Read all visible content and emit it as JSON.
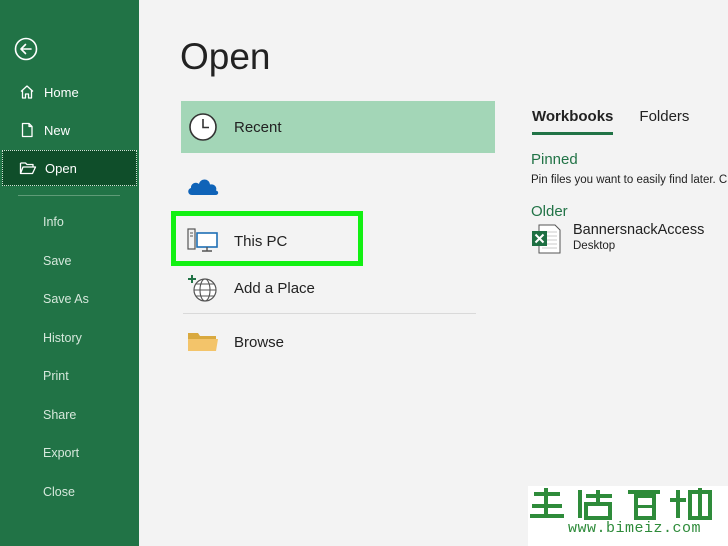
{
  "sidebar": {
    "primary": [
      {
        "label": "Home",
        "icon": "home-icon"
      },
      {
        "label": "New",
        "icon": "new-document-icon"
      },
      {
        "label": "Open",
        "icon": "open-folder-icon",
        "active": true
      }
    ],
    "secondary": [
      "Info",
      "Save",
      "Save As",
      "History",
      "Print",
      "Share",
      "Export",
      "Close"
    ],
    "bg_color": "#217346"
  },
  "main": {
    "title": "Open",
    "locations": [
      {
        "label": "Recent",
        "icon": "clock-icon",
        "selected": true
      },
      {
        "label": "",
        "icon": "onedrive-cloud-icon"
      },
      {
        "label": "This PC",
        "icon": "computer-icon"
      },
      {
        "label": "Add a Place",
        "icon": "add-place-globe-icon"
      },
      {
        "label": "Browse",
        "icon": "folder-icon"
      }
    ]
  },
  "right": {
    "tabs": [
      {
        "label": "Workbooks",
        "active": true
      },
      {
        "label": "Folders"
      }
    ],
    "pinned_heading": "Pinned",
    "pinned_hint": "Pin files you want to easily find later. C",
    "older_heading": "Older",
    "files": [
      {
        "name": "BannersnackAccess",
        "location": "Desktop",
        "icon": "excel-file-icon"
      }
    ]
  },
  "watermark": {
    "url": "www.bimeiz.com"
  },
  "colors": {
    "accent": "#217346",
    "highlight": "#12f012",
    "selected": "#a3d6b7"
  }
}
